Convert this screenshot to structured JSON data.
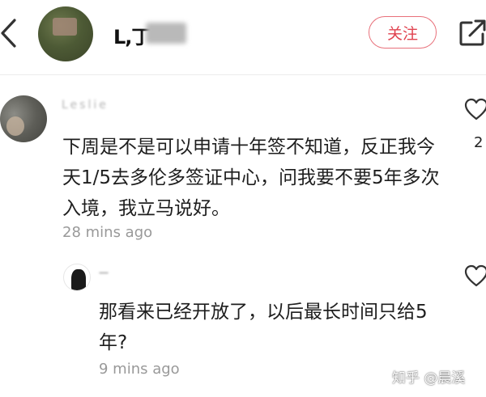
{
  "header": {
    "username": "L,丁",
    "follow_label": "关注"
  },
  "comments": [
    {
      "author": "Leslie",
      "text": "下周是不是可以申请十年签不知道，反正我今天1/5去多伦多签证中心，问我要不要5年多次入境，我立马说好。",
      "time": "28 mins ago",
      "likes": "2"
    }
  ],
  "reply": {
    "author": "一",
    "text": "那看来已经开放了，以后最长时间只给5年?",
    "time": "9 mins ago"
  },
  "watermark": "知乎 @晨溪",
  "colors": {
    "accent": "#e0424f",
    "muted_text": "#999999",
    "icon": "#333333"
  },
  "icons": {
    "back": "chevron-left-icon",
    "share": "share-icon",
    "like": "heart-icon"
  }
}
